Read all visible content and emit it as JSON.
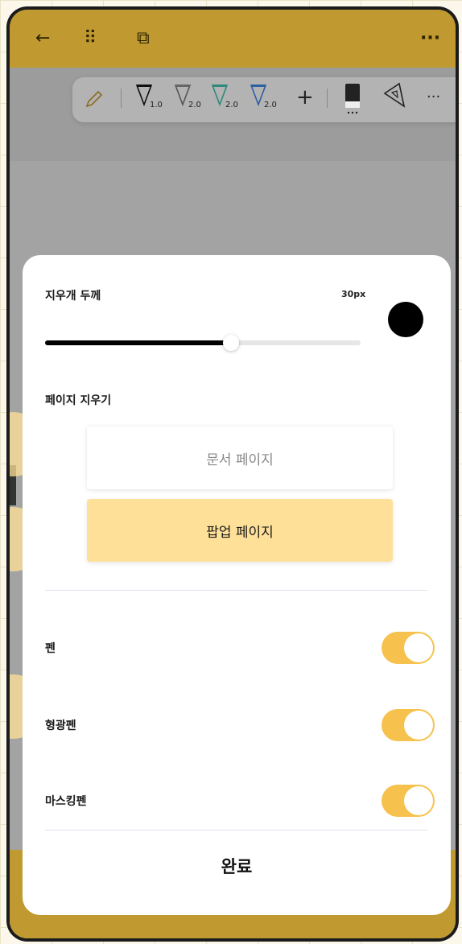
{
  "topbar": {
    "back_icon": "←",
    "grid_icon": "⠿",
    "shape_icon": "⧉",
    "more_icon": "···"
  },
  "toolbar": {
    "pens": [
      {
        "label": "1.0",
        "color": "#111111"
      },
      {
        "label": "2.0",
        "color": "#666666"
      },
      {
        "label": "2.0",
        "color": "#2d8a7a"
      },
      {
        "label": "2.0",
        "color": "#2f5fa3"
      }
    ],
    "add_icon": "+",
    "more_icon": "···"
  },
  "sheet": {
    "eraser_thickness_label": "지우개 두께",
    "thickness_value": "30px",
    "thickness_fraction": 0.59,
    "clear_page_label": "페이지 지우기",
    "document_page_button": "문서 페이지",
    "popup_page_button": "팝업 페이지",
    "toggles": [
      {
        "label": "펜",
        "on": true
      },
      {
        "label": "형광펜",
        "on": true
      },
      {
        "label": "마스킹펜",
        "on": true
      }
    ],
    "done_button": "완료"
  },
  "colors": {
    "accent_yellow": "#F6C24D",
    "topbar": "#C09A30",
    "popup_button_bg": "#FFE099"
  }
}
